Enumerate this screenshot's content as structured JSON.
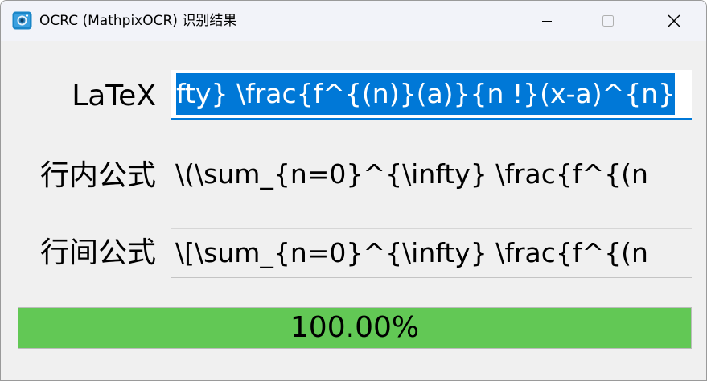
{
  "window": {
    "title": "OCRC (MathpixOCR) 识别结果"
  },
  "titlebar": {
    "minimize_icon": "minimize-icon",
    "maximize_icon": "maximize-icon",
    "close_icon": "close-icon"
  },
  "rows": [
    {
      "label": "LaTeX",
      "value": "fty} \\frac{f^{(n)}(a)}{n !}(x-a)^{n}"
    },
    {
      "label": "行内公式",
      "value": "\\(\\sum_{n=0}^{\\infty} \\frac{f^{(n"
    },
    {
      "label": "行间公式",
      "value": "\\[\\sum_{n=0}^{\\infty} \\frac{f^{(n"
    }
  ],
  "progress": {
    "text": "100.00%",
    "value": 100
  },
  "colors": {
    "selection": "#0078d7",
    "progress_fill": "#62c855",
    "icon_blue": "#1a86c8"
  }
}
